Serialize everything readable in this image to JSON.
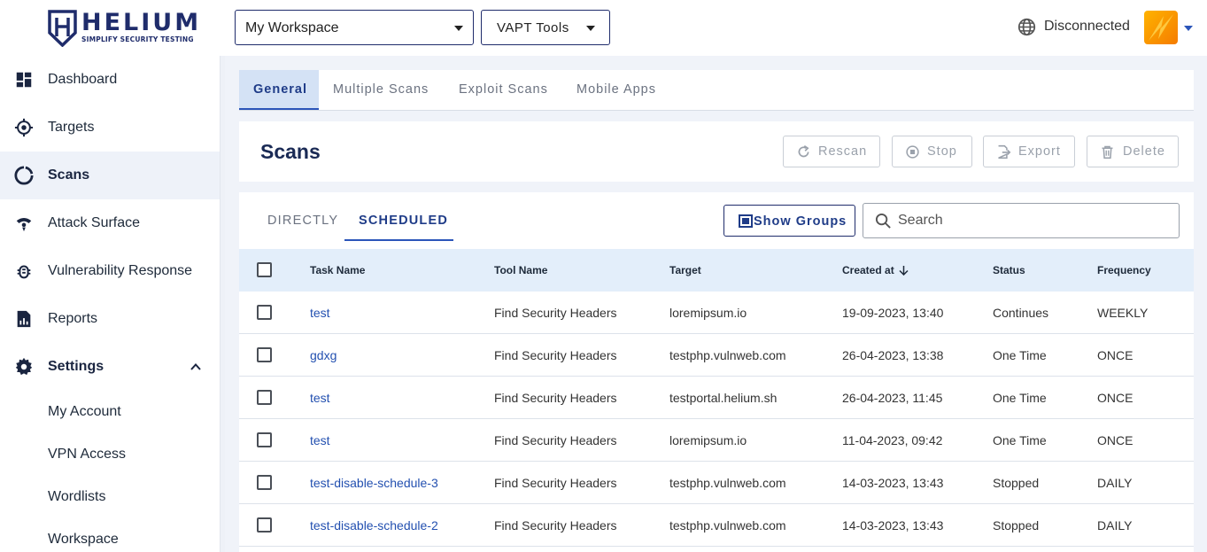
{
  "header": {
    "logo_text": "HELIUM",
    "logo_tagline": "SIMPLIFY SECURITY TESTING",
    "workspace_select": "My Workspace",
    "tools_select": "VAPT Tools",
    "connection_status": "Disconnected"
  },
  "sidebar": {
    "items": [
      {
        "label": "Dashboard",
        "icon": "dashboard-icon"
      },
      {
        "label": "Targets",
        "icon": "target-icon"
      },
      {
        "label": "Scans",
        "icon": "scans-icon"
      },
      {
        "label": "Attack Surface",
        "icon": "attack-surface-icon"
      },
      {
        "label": "Vulnerability Response",
        "icon": "bug-icon"
      },
      {
        "label": "Reports",
        "icon": "reports-icon"
      },
      {
        "label": "Settings",
        "icon": "gear-icon"
      }
    ],
    "settings_sub": [
      "My Account",
      "VPN Access",
      "Wordlists",
      "Workspace"
    ]
  },
  "tabs": [
    "General",
    "Multiple Scans",
    "Exploit Scans",
    "Mobile Apps"
  ],
  "scans": {
    "title": "Scans",
    "actions": {
      "rescan": "Rescan",
      "stop": "Stop",
      "export": "Export",
      "delete": "Delete"
    }
  },
  "panel": {
    "subtabs": [
      "DIRECTLY",
      "SCHEDULED"
    ],
    "show_groups": "Show Groups",
    "search_placeholder": "Search"
  },
  "table": {
    "columns": [
      "Task Name",
      "Tool Name",
      "Target",
      "Created at",
      "Status",
      "Frequency"
    ],
    "rows": [
      {
        "task": "test",
        "tool": "Find Security Headers",
        "target": "loremipsum.io",
        "created": "19-09-2023, 13:40",
        "status": "Continues",
        "freq": "WEEKLY"
      },
      {
        "task": "gdxg",
        "tool": "Find Security Headers",
        "target": "testphp.vulnweb.com",
        "created": "26-04-2023, 13:38",
        "status": "One Time",
        "freq": "ONCE"
      },
      {
        "task": "test",
        "tool": "Find Security Headers",
        "target": "testportal.helium.sh",
        "created": "26-04-2023, 11:45",
        "status": "One Time",
        "freq": "ONCE"
      },
      {
        "task": "test",
        "tool": "Find Security Headers",
        "target": "loremipsum.io",
        "created": "11-04-2023, 09:42",
        "status": "One Time",
        "freq": "ONCE"
      },
      {
        "task": "test-disable-schedule-3",
        "tool": "Find Security Headers",
        "target": "testphp.vulnweb.com",
        "created": "14-03-2023, 13:43",
        "status": "Stopped",
        "freq": "DAILY"
      },
      {
        "task": "test-disable-schedule-2",
        "tool": "Find Security Headers",
        "target": "testphp.vulnweb.com",
        "created": "14-03-2023, 13:43",
        "status": "Stopped",
        "freq": "DAILY"
      }
    ]
  }
}
